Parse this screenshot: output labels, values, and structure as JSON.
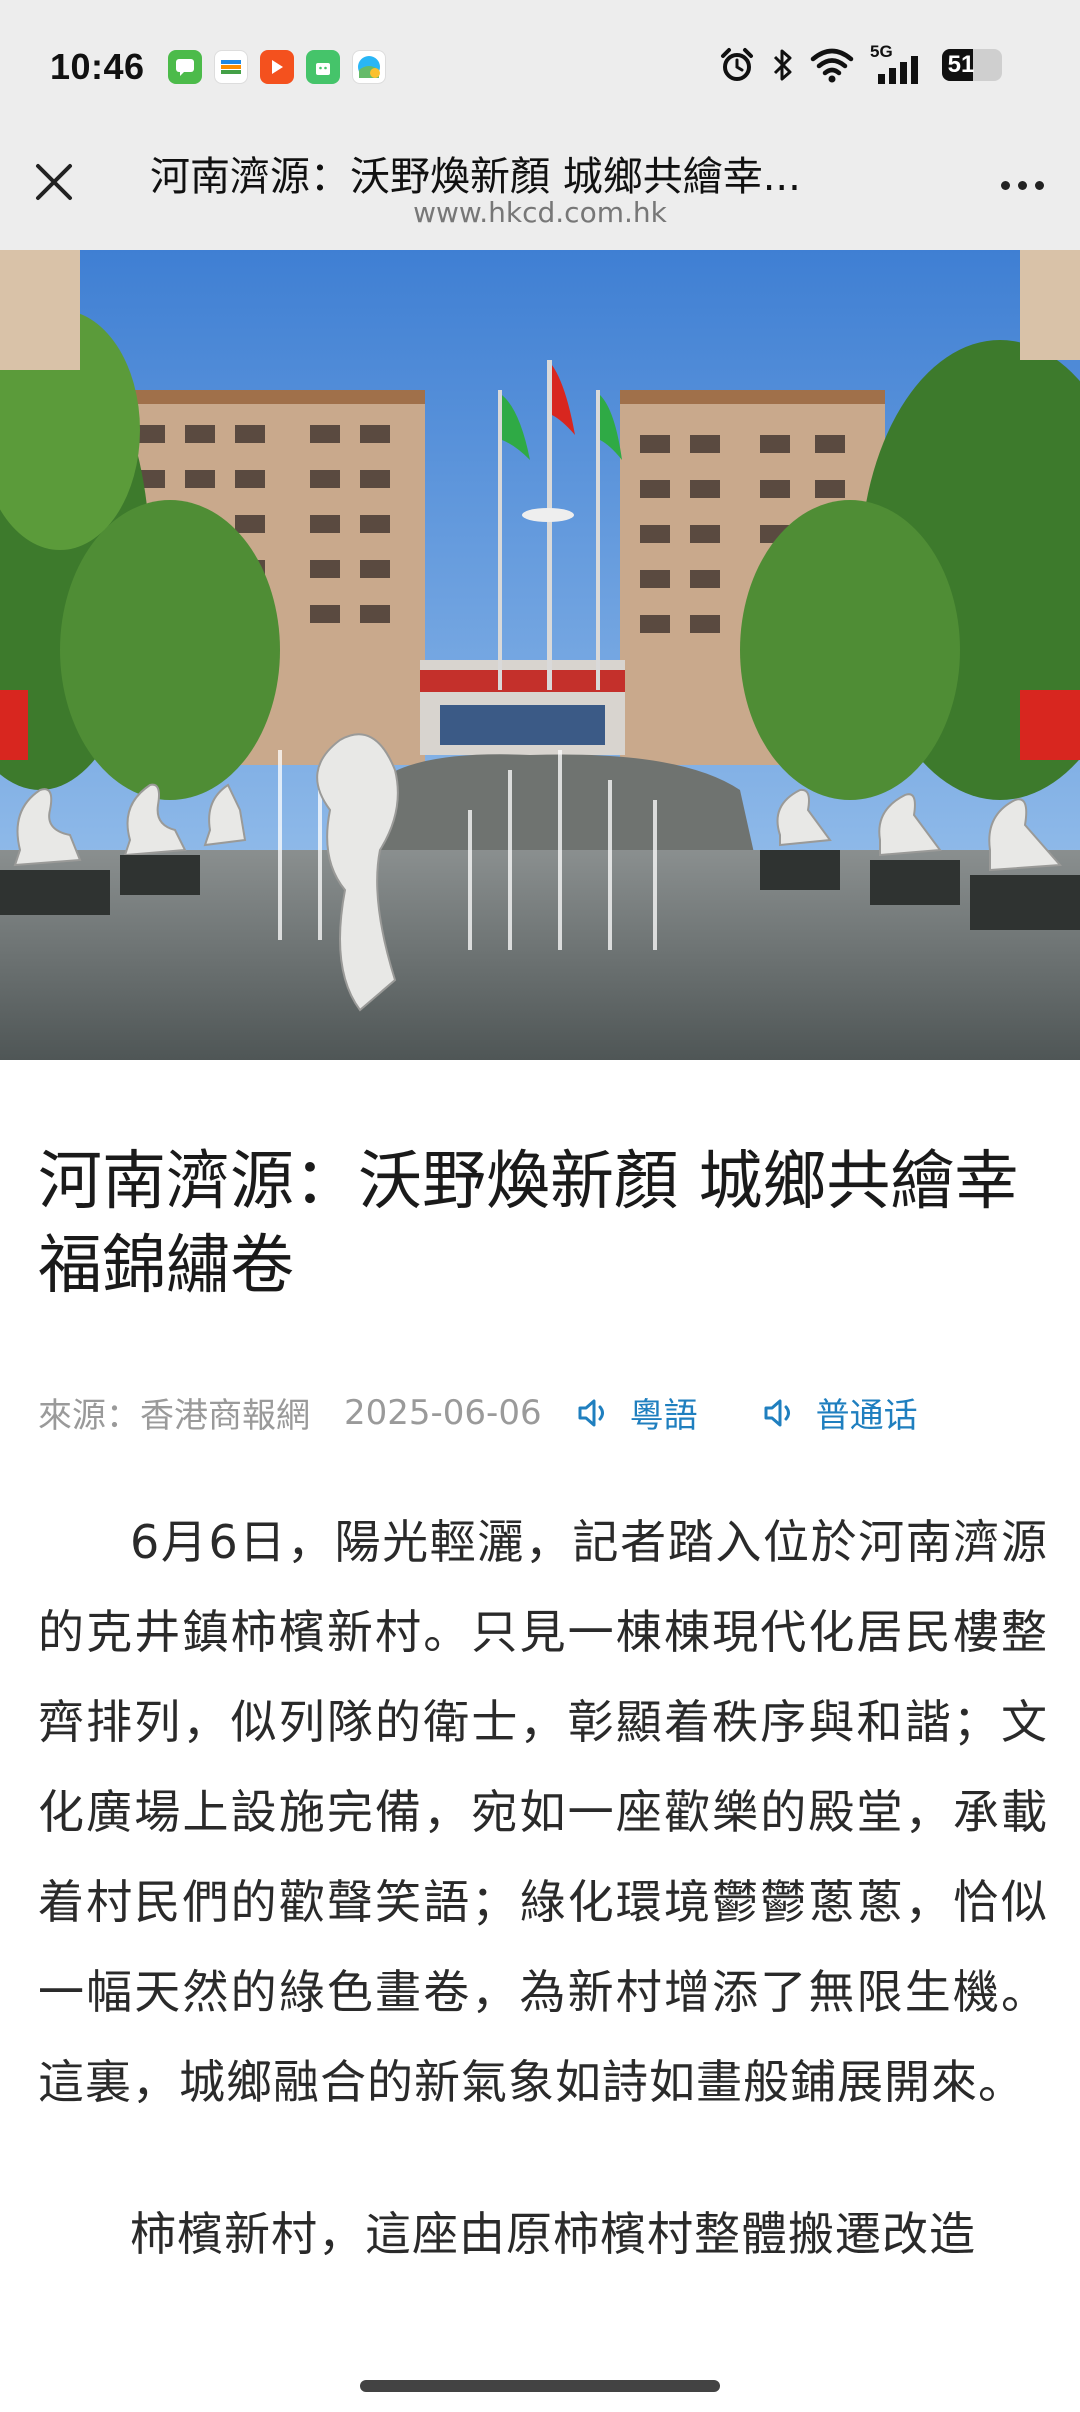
{
  "status": {
    "time": "10:46",
    "network": "5G",
    "battery": "51",
    "battery_level": 0.51
  },
  "title_bar": {
    "title": "河南濟源：沃野煥新顏 城鄉共繪幸...",
    "url": "www.hkcd.com.hk"
  },
  "article": {
    "headline": "河南濟源：沃野煥新顏 城鄉共繪幸福錦繡卷",
    "source": "來源：香港商報網",
    "date": "2025-06-06",
    "audio_cantonese": "粵語",
    "audio_mandarin": "普通话",
    "paragraph1": "6月6日，陽光輕灑，記者踏入位於河南濟源的克井鎮柿檳新村。只見一棟棟現代化居民樓整齊排列，似列隊的衛士，彰顯着秩序與和諧；文化廣場上設施完備，宛如一座歡樂的殿堂，承載着村民們的歡聲笑語；綠化環境鬱鬱蔥蔥，恰似一幅天然的綠色畫卷，為新村增添了無限生機。這裏，城鄉融合的新氣象如詩如畫般鋪展開來。",
    "paragraph2": "柿檳新村，這座由原柿檳村整體搬遷改造"
  }
}
